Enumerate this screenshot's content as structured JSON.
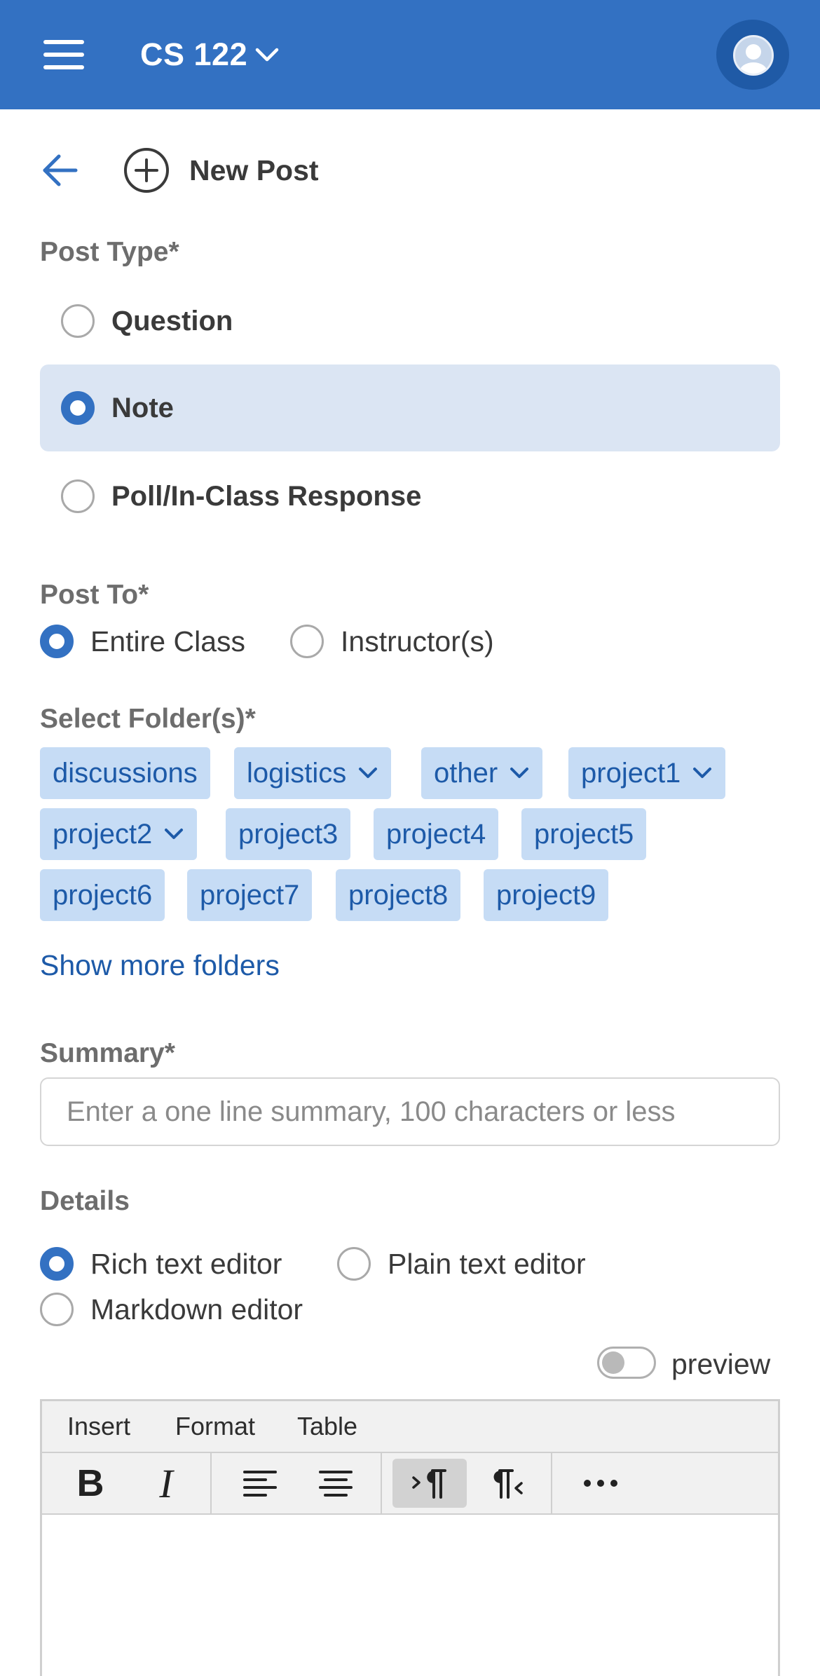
{
  "header": {
    "course_title": "CS 122",
    "menu_icon": "hamburger-menu-icon",
    "avatar_icon": "user-avatar-icon"
  },
  "page": {
    "title": "New Post",
    "back_icon": "back-arrow-icon",
    "new_post_icon": "plus-circle-icon"
  },
  "post_type": {
    "label": "Post Type*",
    "options": [
      {
        "label": "Question",
        "selected": false
      },
      {
        "label": "Note",
        "selected": true
      },
      {
        "label": "Poll/In-Class Response",
        "selected": false
      }
    ]
  },
  "post_to": {
    "label": "Post To*",
    "options": [
      {
        "label": "Entire Class",
        "selected": true
      },
      {
        "label": "Instructor(s)",
        "selected": false
      }
    ]
  },
  "folders": {
    "label": "Select Folder(s)*",
    "items": [
      {
        "label": "discussions",
        "has_dropdown": false
      },
      {
        "label": "logistics",
        "has_dropdown": true
      },
      {
        "label": "other",
        "has_dropdown": true
      },
      {
        "label": "project1",
        "has_dropdown": true
      },
      {
        "label": "project2",
        "has_dropdown": true
      },
      {
        "label": "project3",
        "has_dropdown": false
      },
      {
        "label": "project4",
        "has_dropdown": false
      },
      {
        "label": "project5",
        "has_dropdown": false
      },
      {
        "label": "project6",
        "has_dropdown": false
      },
      {
        "label": "project7",
        "has_dropdown": false
      },
      {
        "label": "project8",
        "has_dropdown": false
      },
      {
        "label": "project9",
        "has_dropdown": false
      }
    ],
    "show_more": "Show more folders"
  },
  "summary": {
    "label": "Summary*",
    "value": "",
    "placeholder": "Enter a one line summary, 100 characters or less"
  },
  "details": {
    "label": "Details",
    "editors": [
      {
        "label": "Rich text editor",
        "selected": true
      },
      {
        "label": "Plain text editor",
        "selected": false
      },
      {
        "label": "Markdown editor",
        "selected": false
      }
    ],
    "preview_label": "preview",
    "preview_on": false
  },
  "editor": {
    "menu": [
      "Insert",
      "Format",
      "Table"
    ],
    "tools": [
      "bold-icon",
      "italic-icon",
      "align-left-icon",
      "align-center-icon",
      "ltr-paragraph-icon",
      "rtl-paragraph-icon",
      "more-options-icon"
    ],
    "active_tool": "ltr-paragraph-icon",
    "content": ""
  },
  "colors": {
    "brand": "#3371c2",
    "chip_bg": "#c6dcf5",
    "chip_text": "#1d5aa8",
    "selected_option_bg": "#dbe5f3"
  }
}
